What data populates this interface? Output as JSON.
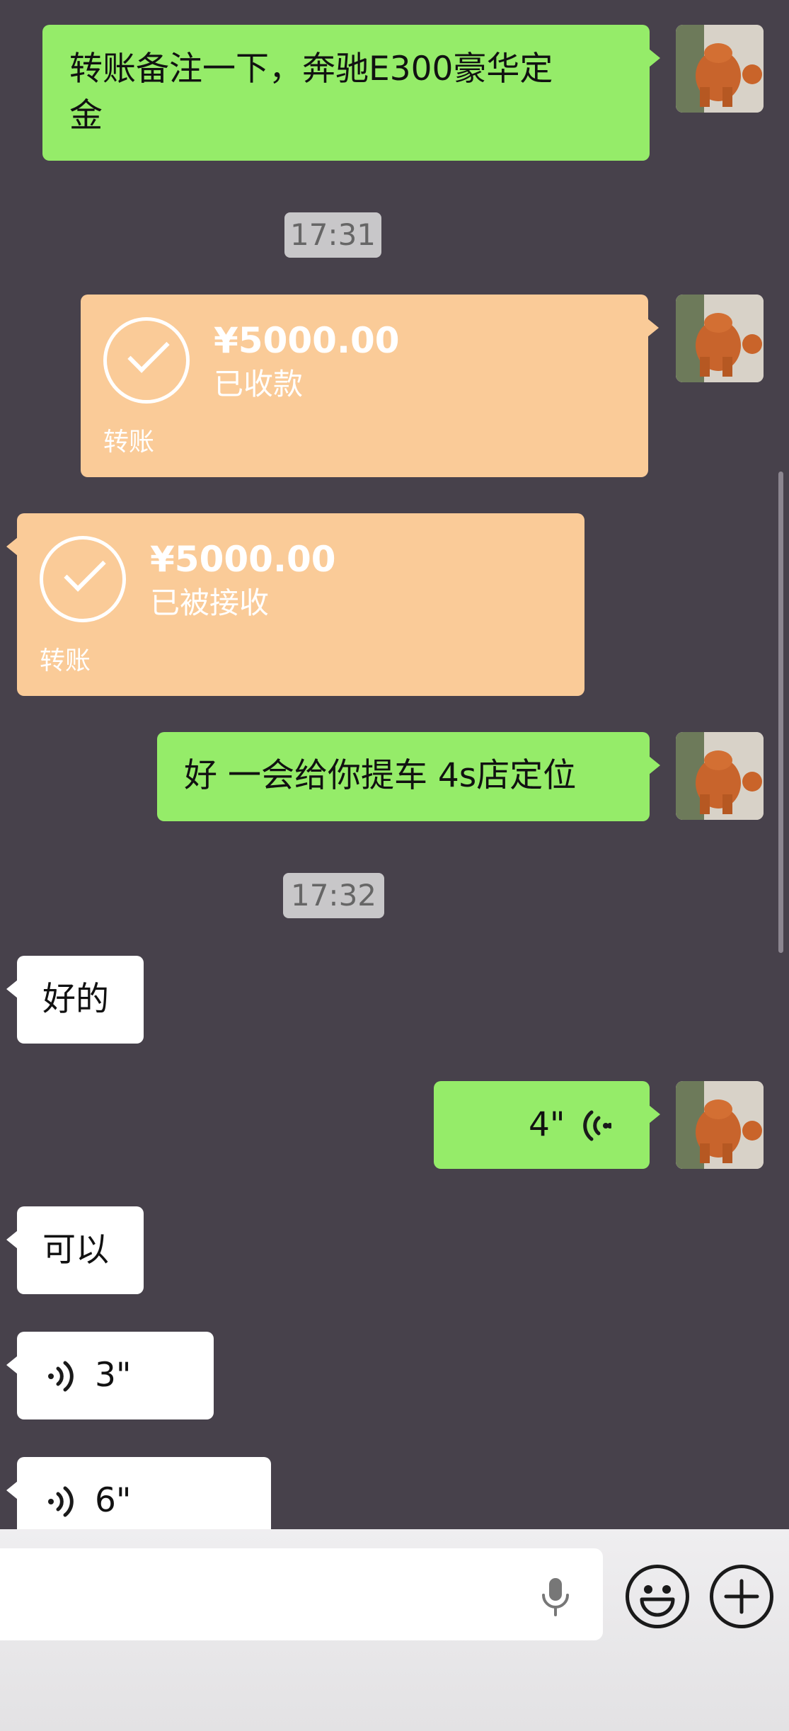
{
  "messages": {
    "m1": "转账备注一下，奔驰E300豪华定\n金",
    "time1": "17:31",
    "transfer_sent": {
      "amount": "¥5000.00",
      "status": "已收款",
      "label": "转账"
    },
    "transfer_received": {
      "amount": "¥5000.00",
      "status": "已被接收",
      "label": "转账"
    },
    "m2": "好 一会给你提车 4s店定位",
    "time2": "17:32",
    "m3": "好的",
    "voice_sent": "4\"",
    "m4": "可以",
    "voice1": "3\"",
    "voice2": "6\""
  },
  "input_bar": {
    "icons": [
      "microphone-icon",
      "emoji-icon",
      "plus-icon"
    ]
  },
  "colors": {
    "background": "#47414b",
    "sent_bubble": "#95ec69",
    "received_bubble": "#ffffff",
    "transfer_bubble": "#facb98"
  }
}
